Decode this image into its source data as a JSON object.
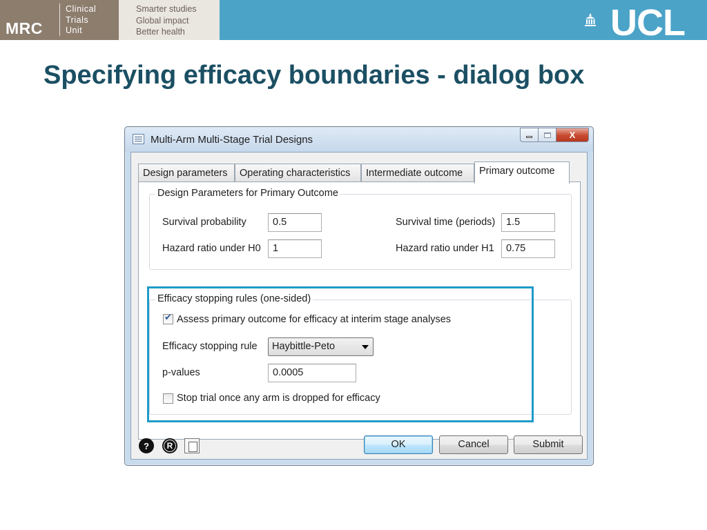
{
  "slide": {
    "logo_mrc": "MRC",
    "logo_unit_lines": [
      "Clinical",
      "Trials",
      "Unit"
    ],
    "tagline_lines": [
      "Smarter studies",
      "Global impact",
      "Better health"
    ],
    "logo_ucl": "UCL",
    "title": "Specifying efficacy boundaries - dialog box"
  },
  "window": {
    "title": "Multi-Arm Multi-Stage Trial Designs",
    "close_glyph": "X"
  },
  "tabs": [
    {
      "label": "Design parameters",
      "active": false
    },
    {
      "label": "Operating characteristics",
      "active": false
    },
    {
      "label": "Intermediate outcome",
      "active": false
    },
    {
      "label": "Primary outcome",
      "active": true
    }
  ],
  "design_group": {
    "title": "Design Parameters for Primary Outcome",
    "survival_probability": {
      "label": "Survival probability",
      "value": "0.5"
    },
    "survival_time": {
      "label": "Survival time (periods)",
      "value": "1.5"
    },
    "hazard_h0": {
      "label": "Hazard ratio under H0",
      "value": "1"
    },
    "hazard_h1": {
      "label": "Hazard ratio under H1",
      "value": "0.75"
    }
  },
  "efficacy_group": {
    "title": "Efficacy stopping rules (one-sided)",
    "assess_checkbox": {
      "label": "Assess primary outcome for efficacy at interim stage analyses",
      "checked": true
    },
    "stopping_rule": {
      "label": "Efficacy stopping rule",
      "value": "Haybittle-Peto"
    },
    "p_values": {
      "label": "p-values",
      "value": "0.0005"
    },
    "stop_trial_checkbox": {
      "label": "Stop trial once any arm is dropped for efficacy",
      "checked": false
    }
  },
  "bottom_bar": {
    "help_icon": "?",
    "r_icon": "R",
    "ok_label": "OK",
    "cancel_label": "Cancel",
    "submit_label": "Submit"
  },
  "colors": {
    "title_text": "#1b4f63",
    "ucl_banner": "#4ba3c8",
    "mrc_banner": "#8c7d6d",
    "highlight_border": "#1f9bc8"
  }
}
